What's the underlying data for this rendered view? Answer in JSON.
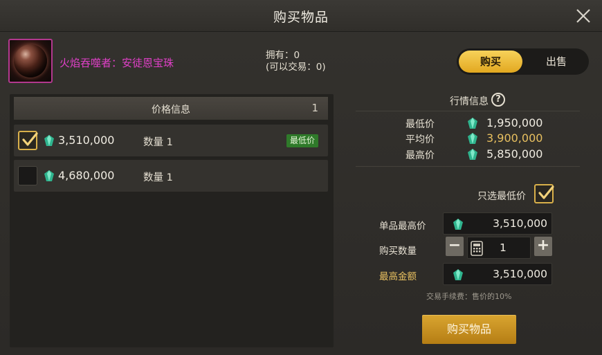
{
  "window": {
    "title": "购买物品"
  },
  "item": {
    "name": "火焰吞噬者：安徒恩宝珠",
    "owned": "拥有：0",
    "tradable": "(可以交易：0)"
  },
  "mode": {
    "buy_label": "购买",
    "sell_label": "出售",
    "active": "buy"
  },
  "price_list": {
    "header_label": "价格信息",
    "header_count": "1",
    "listings": [
      {
        "checked": true,
        "price": "3,510,000",
        "quantity": "数量 1",
        "badge": "最低价"
      },
      {
        "checked": false,
        "price": "4,680,000",
        "quantity": "数量 1",
        "badge": ""
      }
    ]
  },
  "market": {
    "title": "行情信息",
    "help_icon": "?",
    "min_label": "最低价",
    "min_value": "1,950,000",
    "avg_label": "平均价",
    "avg_value": "3,900,000",
    "max_label": "最高价",
    "max_value": "5,850,000"
  },
  "order": {
    "only_lowest_label": "只选最低价",
    "only_lowest_checked": true,
    "unit_max_label": "单品最高价",
    "unit_max_value": "3,510,000",
    "qty_label": "购买数量",
    "qty_value": "1",
    "total_label": "最高金额",
    "total_value": "3,510,000",
    "minus": "−",
    "plus": "+",
    "fee_note": "交易手续费：售价的10%",
    "buy_button": "购买物品"
  },
  "colors": {
    "accent_gold": "#e2a820",
    "item_name": "#e040c8",
    "badge_green": "#2f7a2a",
    "gem": "#3ec9a0"
  },
  "icons": {
    "close": "close-icon",
    "gem": "gem-icon",
    "calculator": "calculator-icon",
    "check": "check-icon"
  }
}
